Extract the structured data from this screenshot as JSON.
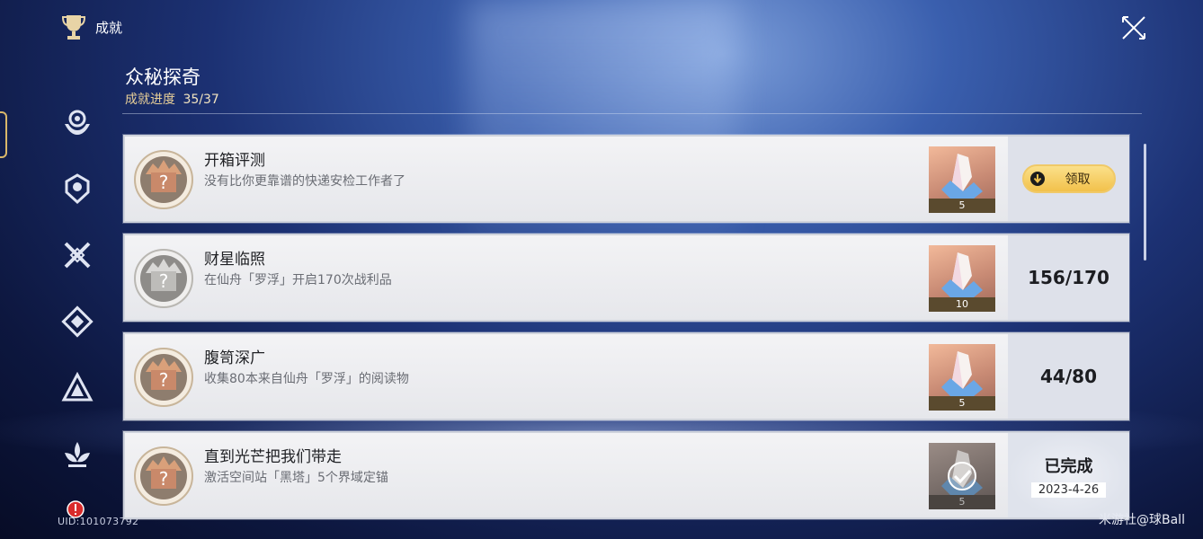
{
  "header": {
    "title": "成就",
    "trophy_icon": "trophy-icon",
    "close_icon": "close-icon"
  },
  "section": {
    "title": "众秘探奇",
    "progress_label": "成就进度",
    "progress_value": "35/37"
  },
  "sidebar": {
    "items": [
      {
        "icon": "emblem-hands-icon"
      },
      {
        "icon": "emblem-helmet-icon"
      },
      {
        "icon": "emblem-crossed-swords-icon"
      },
      {
        "icon": "emblem-diamond-icon"
      },
      {
        "icon": "emblem-triangle-icon"
      },
      {
        "icon": "emblem-lotus-icon"
      }
    ],
    "alert_icon": "alert-icon"
  },
  "uid": "UID:101073792",
  "achievements": [
    {
      "title": "开箱评测",
      "description": "没有比你更靠谱的快递安检工作者了",
      "reward_count": "5",
      "status_type": "claim",
      "claim_label": "领取"
    },
    {
      "title": "财星临照",
      "description": "在仙舟「罗浮」开启170次战利品",
      "reward_count": "10",
      "status_type": "progress",
      "progress": "156/170"
    },
    {
      "title": "腹笥深广",
      "description": "收集80本来自仙舟「罗浮」的阅读物",
      "reward_count": "5",
      "status_type": "progress",
      "progress": "44/80"
    },
    {
      "title": "直到光芒把我们带走",
      "description": "激活空间站「黑塔」5个界域定锚",
      "reward_count": "5",
      "status_type": "completed",
      "completed_label": "已完成",
      "completed_date": "2023-4-26"
    }
  ],
  "watermark": "米游社@球Ball",
  "colors": {
    "accent_gold": "#f2c14b",
    "progress_text": "#e8cf98",
    "card_bg": "#eeeef1",
    "reward_bg": "#c88a74"
  }
}
